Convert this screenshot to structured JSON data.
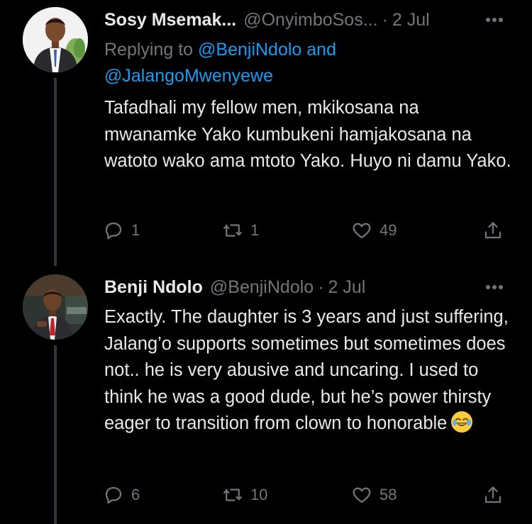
{
  "tweets": [
    {
      "display_name": "Sosy Msemak...",
      "handle": "@OnyimboSos...",
      "separator": "·",
      "date": "2 Jul",
      "replying_prefix": "Replying to ",
      "replying_mention_1": "@BenjiNdolo",
      "replying_and": " and",
      "replying_mention_2": "@JalangoMwenyewe",
      "text": "Tafadhali my fellow men, mkikosana na mwanamke Yako kumbukeni hamjakosana na watoto wako ama mtoto Yako. Huyo ni damu Yako.",
      "replies": "1",
      "retweets": "1",
      "likes": "49",
      "avatar_icon": "profile-photo-man-in-suit"
    },
    {
      "display_name": "Benji Ndolo",
      "handle": "@BenjiNdolo",
      "separator": "·",
      "date": "2 Jul",
      "text": "Exactly. The daughter is 3 years and just suffering, Jalang’o supports sometimes but sometimes does not.. he is very abusive and uncaring. I used to think he was a good dude, but he’s power thirsty eager to transition from clown to honorable",
      "emoji": "face-with-tears-of-joy",
      "replies": "6",
      "retweets": "10",
      "likes": "58",
      "avatar_icon": "profile-photo-man-seated"
    }
  ],
  "icons": {
    "reply": "reply-icon",
    "retweet": "retweet-icon",
    "like": "heart-icon",
    "share": "share-icon",
    "more": "more-options-icon"
  },
  "colors": {
    "background": "#000000",
    "primary_text": "#e7e9ea",
    "secondary_text": "#71767b",
    "link": "#1d9bf0",
    "thread_line": "#333639"
  }
}
